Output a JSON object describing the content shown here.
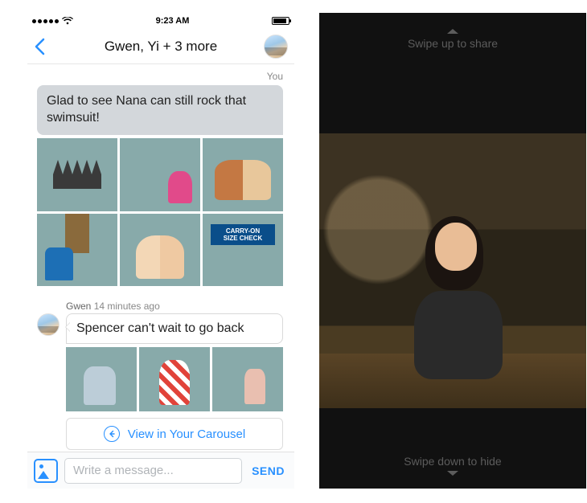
{
  "statusbar": {
    "time": "9:23 AM"
  },
  "nav": {
    "title": "Gwen, Yi + 3 more"
  },
  "you_label": "You",
  "msg_out": {
    "text": "Glad to see Nana can still rock that swimsuit!"
  },
  "msg_in": {
    "sender": "Gwen",
    "time": "14 minutes ago",
    "text": "Spencer can't wait to go back"
  },
  "carousel_button": "View in Your Carousel",
  "composer": {
    "placeholder": "Write a message...",
    "send": "SEND"
  },
  "right": {
    "swipe_up": "Swipe up to share",
    "swipe_down": "Swipe down to hide"
  },
  "thumbs_out": [
    "shark-mouth-family",
    "child-pink-by-water",
    "couple-poolside",
    "thatched-hut-people",
    "grandparents-pool",
    "carry-on-size-check-sign"
  ],
  "thumbs_in": [
    "toddler-holding-hand",
    "girl-red-white-dress",
    "child-walking-hedge"
  ]
}
